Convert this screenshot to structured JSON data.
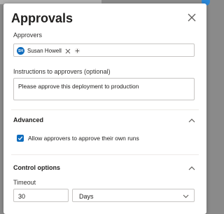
{
  "dialog": {
    "title": "Approvals"
  },
  "approvers": {
    "label": "Approvers",
    "chips": [
      {
        "initials": "SH",
        "name": "Susan Howell",
        "avatar_color": "#0f6cbd"
      }
    ]
  },
  "instructions": {
    "label": "Instructions to approvers (optional)",
    "value": "Please approve this deployment to production"
  },
  "advanced": {
    "title": "Advanced",
    "allow_self_approve": {
      "label": "Allow approvers to approve their own runs",
      "checked": true
    }
  },
  "control_options": {
    "title": "Control options",
    "timeout": {
      "label": "Timeout",
      "value": "30",
      "unit": "Days"
    }
  },
  "colors": {
    "accent": "#0f6cbd",
    "border": "#c8c6c4",
    "text": "#201f1e"
  }
}
